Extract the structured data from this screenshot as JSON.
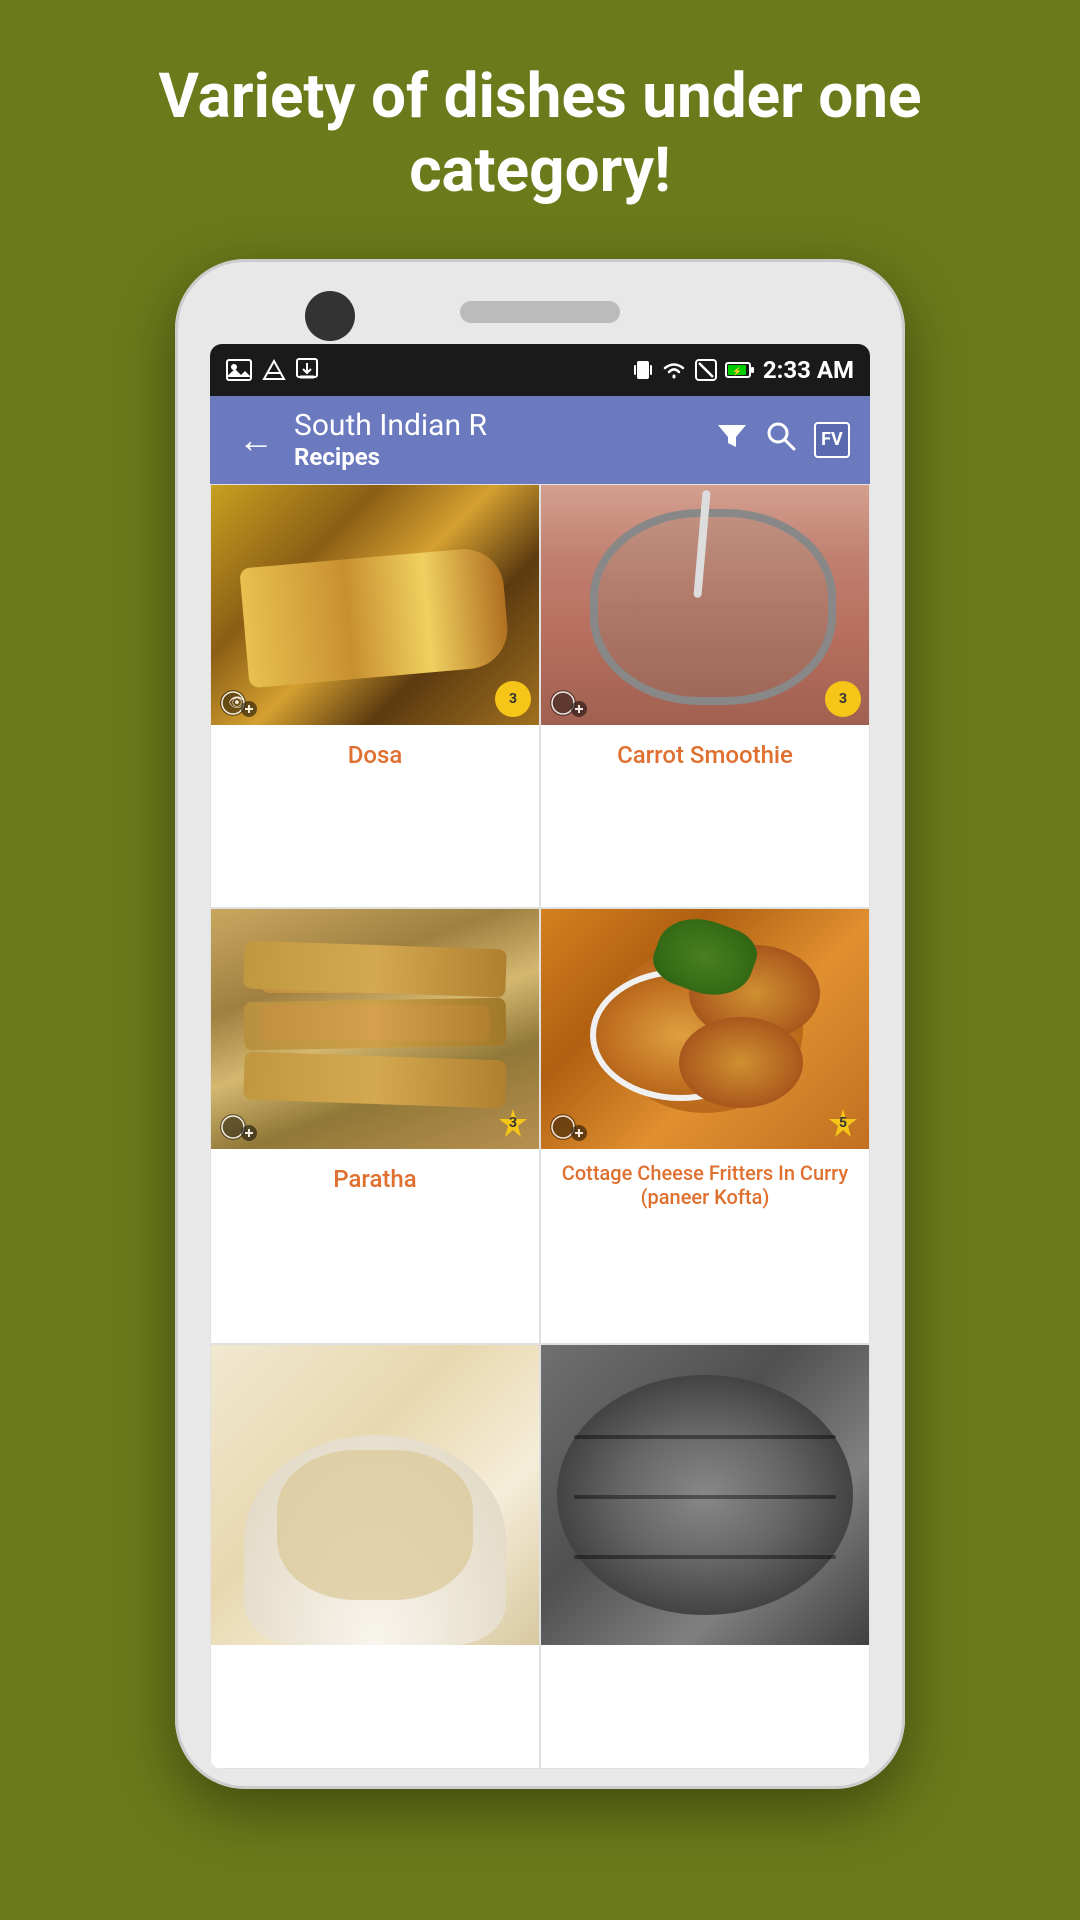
{
  "hero": {
    "text": "Variety of dishes under one category!"
  },
  "status_bar": {
    "time": "2:33 AM",
    "icons": [
      "image",
      "nav",
      "download",
      "vibrate",
      "wifi",
      "signal",
      "battery"
    ]
  },
  "app_bar": {
    "back_icon": "←",
    "title_main": "South Indian R",
    "title_sub": "Recipes",
    "filter_icon": "▼",
    "search_icon": "🔍",
    "shield_label": "FV"
  },
  "recipes": [
    {
      "id": "dosa",
      "name": "Dosa",
      "rating": "3",
      "image_class": "img-dosa"
    },
    {
      "id": "carrot-smoothie",
      "name": "Carrot Smoothie",
      "rating": "3",
      "image_class": "img-carrot-smoothie"
    },
    {
      "id": "paratha",
      "name": "Paratha",
      "rating": "3",
      "image_class": "img-paratha"
    },
    {
      "id": "paneer-kofta",
      "name": "Cottage Cheese Fritters In Curry (paneer Kofta)",
      "rating": "5",
      "image_class": "img-paneer-kofta"
    },
    {
      "id": "item5",
      "name": "",
      "rating": "",
      "image_class": "img-generic1"
    },
    {
      "id": "item6",
      "name": "",
      "rating": "",
      "image_class": "img-generic2"
    }
  ]
}
